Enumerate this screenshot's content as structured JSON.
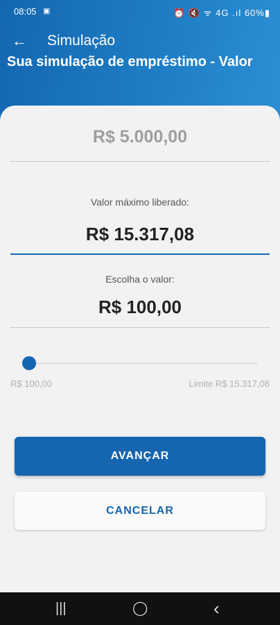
{
  "status_bar": {
    "time": "08:05",
    "notification": "▣",
    "right": "⏰ 🔇 ᯤ 4G .ıl 60%▮"
  },
  "app_bar": {
    "back_icon": "←",
    "title": "Simulação"
  },
  "page": {
    "subtitle": "Sua simulação de empréstimo - Valor"
  },
  "summary": {
    "amount": "R$ 5.000,00"
  },
  "max_section": {
    "label": "Valor máximo liberado:",
    "value": "R$ 15.317,08"
  },
  "choose_section": {
    "label": "Escolha o valor:",
    "value": "R$ 100,00"
  },
  "slider": {
    "value_fraction": 0,
    "min_label": "R$ 100,00",
    "max_label": "Limite R$ 15.317,08"
  },
  "buttons": {
    "advance": "AVANÇAR",
    "cancel": "CANCELAR"
  },
  "nav": {
    "recents": "|||",
    "home": "◯",
    "back": "‹"
  },
  "colors": {
    "primary": "#1565b0",
    "header_gradient_start": "#1467b0",
    "header_gradient_end": "#2c8fd3"
  }
}
